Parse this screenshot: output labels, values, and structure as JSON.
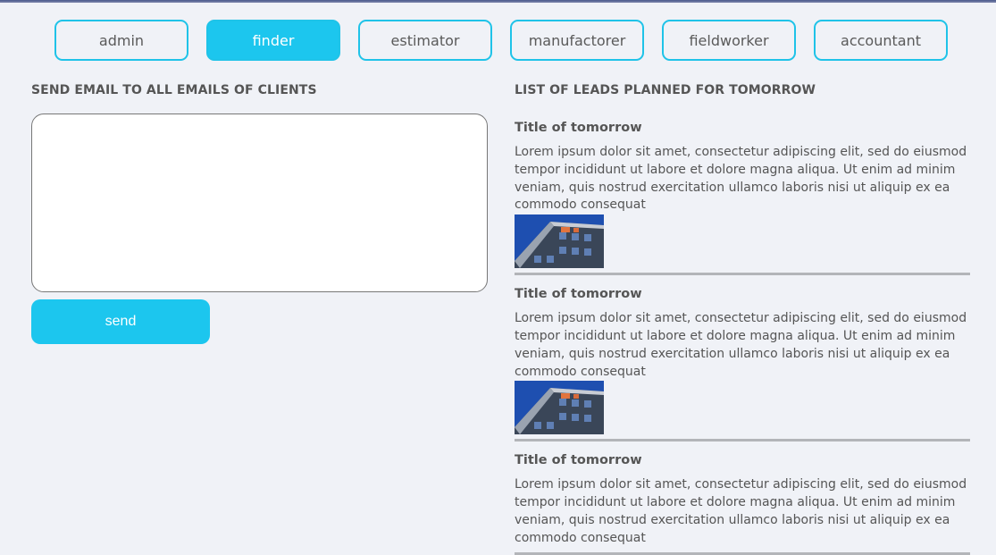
{
  "roles": [
    {
      "label": "admin",
      "active": false
    },
    {
      "label": "finder",
      "active": true
    },
    {
      "label": "estimator",
      "active": false
    },
    {
      "label": "manufactorer",
      "active": false
    },
    {
      "label": "fieldworker",
      "active": false
    },
    {
      "label": "accountant",
      "active": false
    }
  ],
  "email_section": {
    "title": "SEND EMAIL TO ALL EMAILS OF CLIENTS",
    "textarea_value": "",
    "send_label": "send"
  },
  "leads_section": {
    "title": "LIST OF LEADS PLANNED FOR TOMORROW",
    "items": [
      {
        "title": "Title of tomorrow",
        "text": "Lorem ipsum dolor sit amet, consectetur adipiscing elit, sed do eiusmod tempor incididunt ut labore et dolore magna aliqua. Ut enim ad minim veniam, quis nostrud exercitation ullamco laboris nisi ut aliquip ex ea commodo consequat"
      },
      {
        "title": "Title of tomorrow",
        "text": "Lorem ipsum dolor sit amet, consectetur adipiscing elit, sed do eiusmod tempor incididunt ut labore et dolore magna aliqua. Ut enim ad minim veniam, quis nostrud exercitation ullamco laboris nisi ut aliquip ex ea commodo consequat"
      },
      {
        "title": "Title of tomorrow",
        "text": "Lorem ipsum dolor sit amet, consectetur adipiscing elit, sed do eiusmod tempor incididunt ut labore et dolore magna aliqua. Ut enim ad minim veniam, quis nostrud exercitation ullamco laboris nisi ut aliquip ex ea commodo consequat"
      }
    ]
  },
  "colors": {
    "accent": "#1cc6ee",
    "border": "#1fc3e8",
    "background": "#f0f2f7",
    "divider": "#b3b5b9"
  }
}
